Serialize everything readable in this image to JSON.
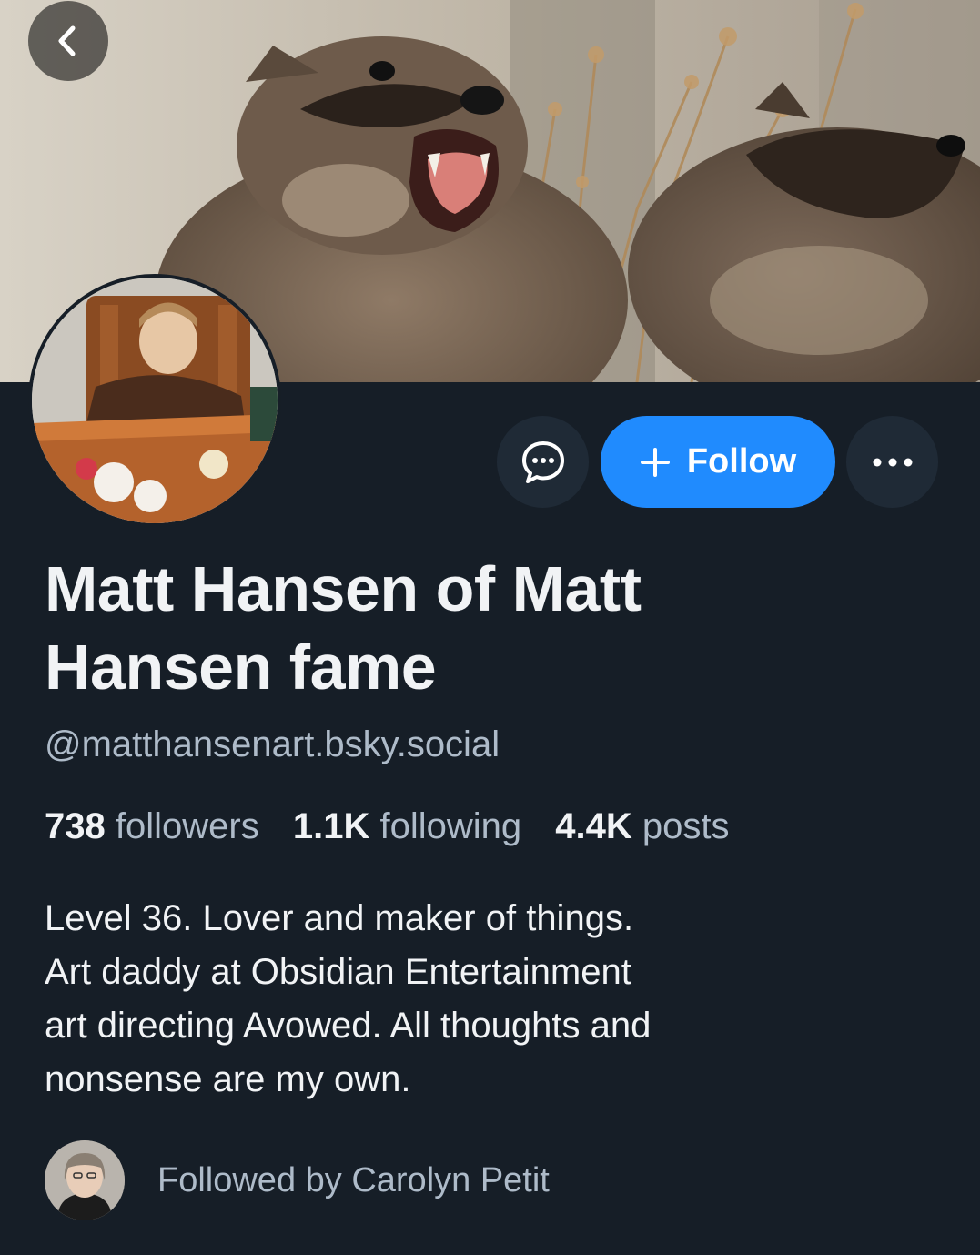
{
  "header": {
    "banner_image": "raccoon-banner-photo",
    "back_icon": "chevron-left-icon"
  },
  "profile": {
    "avatar_image": "child-at-table-photo",
    "display_name": "Matt Hansen of Matt Hansen fame",
    "handle": "@matthansenart.bsky.social",
    "stats": {
      "followers_count": "738",
      "followers_label": "followers",
      "following_count": "1.1K",
      "following_label": "following",
      "posts_count": "4.4K",
      "posts_label": "posts"
    },
    "bio": "Level 36. Lover and maker of things.\nArt daddy at Obsidian Entertainment\nart directing Avowed.  All thoughts and\nnonsense are my own."
  },
  "actions": {
    "message_icon": "chat-bubble-icon",
    "follow_label": "Follow",
    "follow_icon": "plus-icon",
    "more_icon": "ellipsis-icon"
  },
  "followed_by": {
    "text": "Followed by Carolyn Petit",
    "avatar_image": "carolyn-petit-avatar"
  },
  "colors": {
    "background": "#161e27",
    "accent": "#208bfe",
    "secondary_text": "#aebbc9",
    "button_bg": "#1f2a36"
  }
}
